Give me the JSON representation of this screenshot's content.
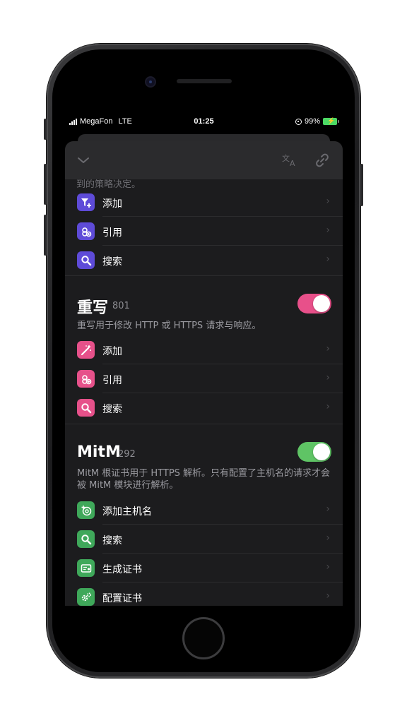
{
  "status_bar": {
    "carrier": "MegaFon",
    "network": "LTE",
    "time": "01:25",
    "battery": "99%"
  },
  "faded_text": "到的策略决定。",
  "top_rows": [
    {
      "label": "添加",
      "icon": "filter-add-icon"
    },
    {
      "label": "引用",
      "icon": "link-add-icon"
    },
    {
      "label": "搜索",
      "icon": "search-icon"
    }
  ],
  "rewrite": {
    "title": "重写",
    "count": "801",
    "description": "重写用于修改 HTTP 或 HTTPS 请求与响应。",
    "enabled": true,
    "rows": [
      {
        "label": "添加",
        "icon": "magic-wand-icon"
      },
      {
        "label": "引用",
        "icon": "link-add-icon"
      },
      {
        "label": "搜索",
        "icon": "search-icon"
      }
    ]
  },
  "mitm": {
    "title": "MitM",
    "count": "292",
    "description": "MitM 根证书用于 HTTPS 解析。只有配置了主机名的请求才会被 MitM 模块进行解析。",
    "enabled": true,
    "rows": [
      {
        "label": "添加主机名",
        "icon": "at-add-icon"
      },
      {
        "label": "搜索",
        "icon": "search-icon"
      },
      {
        "label": "生成证书",
        "icon": "certificate-icon"
      },
      {
        "label": "配置证书",
        "icon": "gears-icon"
      }
    ]
  },
  "colors": {
    "purple": "#5e4bd8",
    "pink": "#e6518a",
    "green": "#3fa85a",
    "toggle_pink": "#e8508a",
    "toggle_green": "#5fc465"
  }
}
